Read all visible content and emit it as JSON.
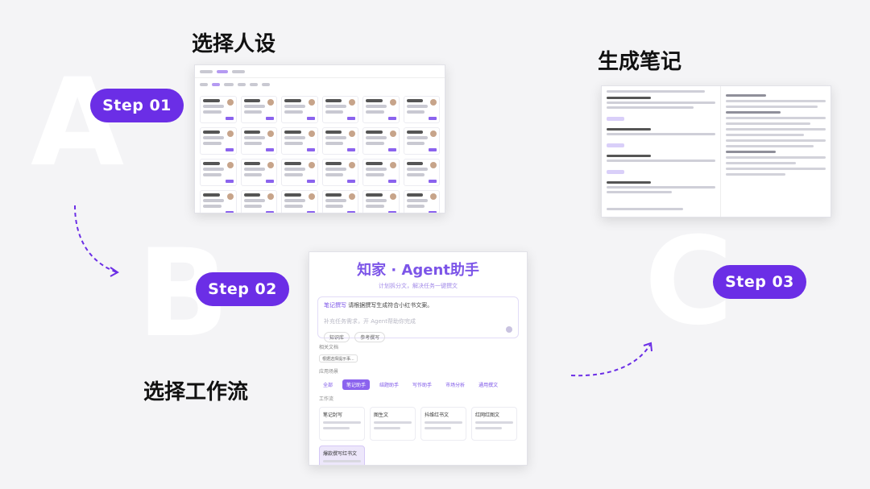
{
  "steps": [
    {
      "letter": "A",
      "pill": "Step 01",
      "title": "选择人设"
    },
    {
      "letter": "B",
      "pill": "Step 02",
      "title": "选择工作流"
    },
    {
      "letter": "C",
      "pill": "Step 03",
      "title": "生成笔记"
    }
  ],
  "shot2": {
    "title": "知家 · Agent助手",
    "subtitle": "计划拆分文，解决任务一键撰文",
    "input_prefix": "笔记撰写",
    "input_text": "请根据撰写生成符合小红书文案。",
    "placeholder": "补充任务需求，开 Agent帮助你完成",
    "chip1": "知识库",
    "chip2": "参考撰写",
    "label_docs": "相关文档",
    "doc_chip": "根据选择提示事...",
    "label_scene": "应用场景",
    "tabs": [
      "全部",
      "笔记助手",
      "结题助手",
      "写作助手",
      "市场分析",
      "通用撰文"
    ],
    "label_flow": "工作流",
    "cards": [
      "笔记封写",
      "图生文",
      "抖维红书文",
      "红网红图文",
      "爆款撰写红书文"
    ]
  },
  "colors": {
    "accent": "#6b2ee6",
    "background": "#f4f4f6"
  }
}
